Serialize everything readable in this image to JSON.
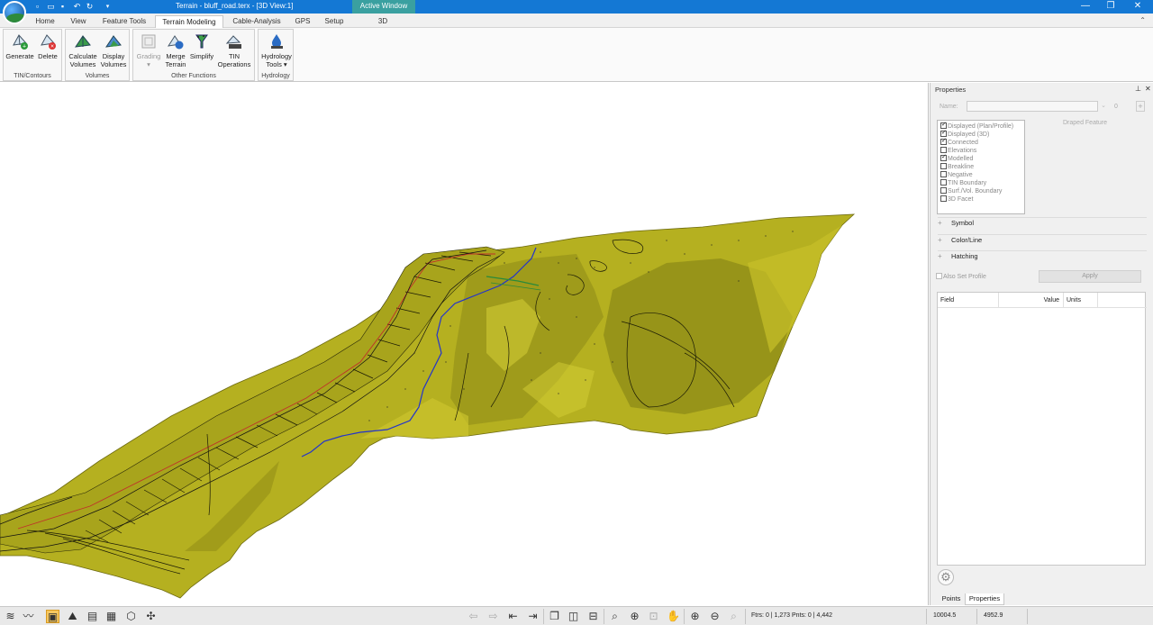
{
  "window": {
    "title": "Terrain - bluff_road.terx - [3D View:1]",
    "active_window_label": "Active Window",
    "accent_color": "#1478d4"
  },
  "tabs": [
    "Home",
    "View",
    "Feature Tools",
    "Terrain Modeling",
    "Cable-Analysis",
    "GPS",
    "Setup",
    "3D"
  ],
  "active_tab": "Terrain Modeling",
  "ribbon": {
    "groups": {
      "tin": "TIN/Contours",
      "volumes": "Volumes",
      "other": "Other Functions",
      "hydrology": "Hydrology"
    },
    "buttons": {
      "generate": "Generate",
      "delete": "Delete",
      "calculate_volumes_1": "Calculate",
      "calculate_volumes_2": "Volumes",
      "display_volumes_1": "Display",
      "display_volumes_2": "Volumes",
      "grading": "Grading",
      "merge_terrain_1": "Merge",
      "merge_terrain_2": "Terrain",
      "simplify": "Simplify",
      "tin_operations_1": "TIN",
      "tin_operations_2": "Operations",
      "hydrology_tools_1": "Hydrology",
      "hydrology_tools_2": "Tools"
    }
  },
  "viewport": {
    "terrain_color": "#b5b020",
    "stream_color": "#2233cc"
  },
  "properties": {
    "title": "Properties",
    "name_label": "Name:",
    "zero_value": "0",
    "draped_feature": "Draped Feature",
    "flags": [
      {
        "label": "Displayed (Plan/Profile)",
        "checked": true
      },
      {
        "label": "Displayed (3D)",
        "checked": true
      },
      {
        "label": "Connected",
        "checked": true
      },
      {
        "label": "Elevations",
        "checked": false
      },
      {
        "label": "Modelled",
        "checked": true
      },
      {
        "label": "Breakline",
        "checked": false
      },
      {
        "label": "Negative",
        "checked": false
      },
      {
        "label": "TIN Boundary",
        "checked": false
      },
      {
        "label": "Surf./Vol. Boundary",
        "checked": false
      },
      {
        "label": "3D Facet",
        "checked": false
      }
    ],
    "sections": [
      "Symbol",
      "Color/Line",
      "Hatching"
    ],
    "also_set_profile": "Also Set Profile",
    "apply": "Apply",
    "grid_headers": [
      "Field",
      "Value",
      "Units"
    ],
    "bottom_tabs": [
      "Points",
      "Properties"
    ],
    "active_bottom_tab": "Properties"
  },
  "status": {
    "counts": "Ftrs: 0 | 1,273  Pnts: 0 | 4,442",
    "x": "10004.5",
    "y": "4952.9"
  }
}
